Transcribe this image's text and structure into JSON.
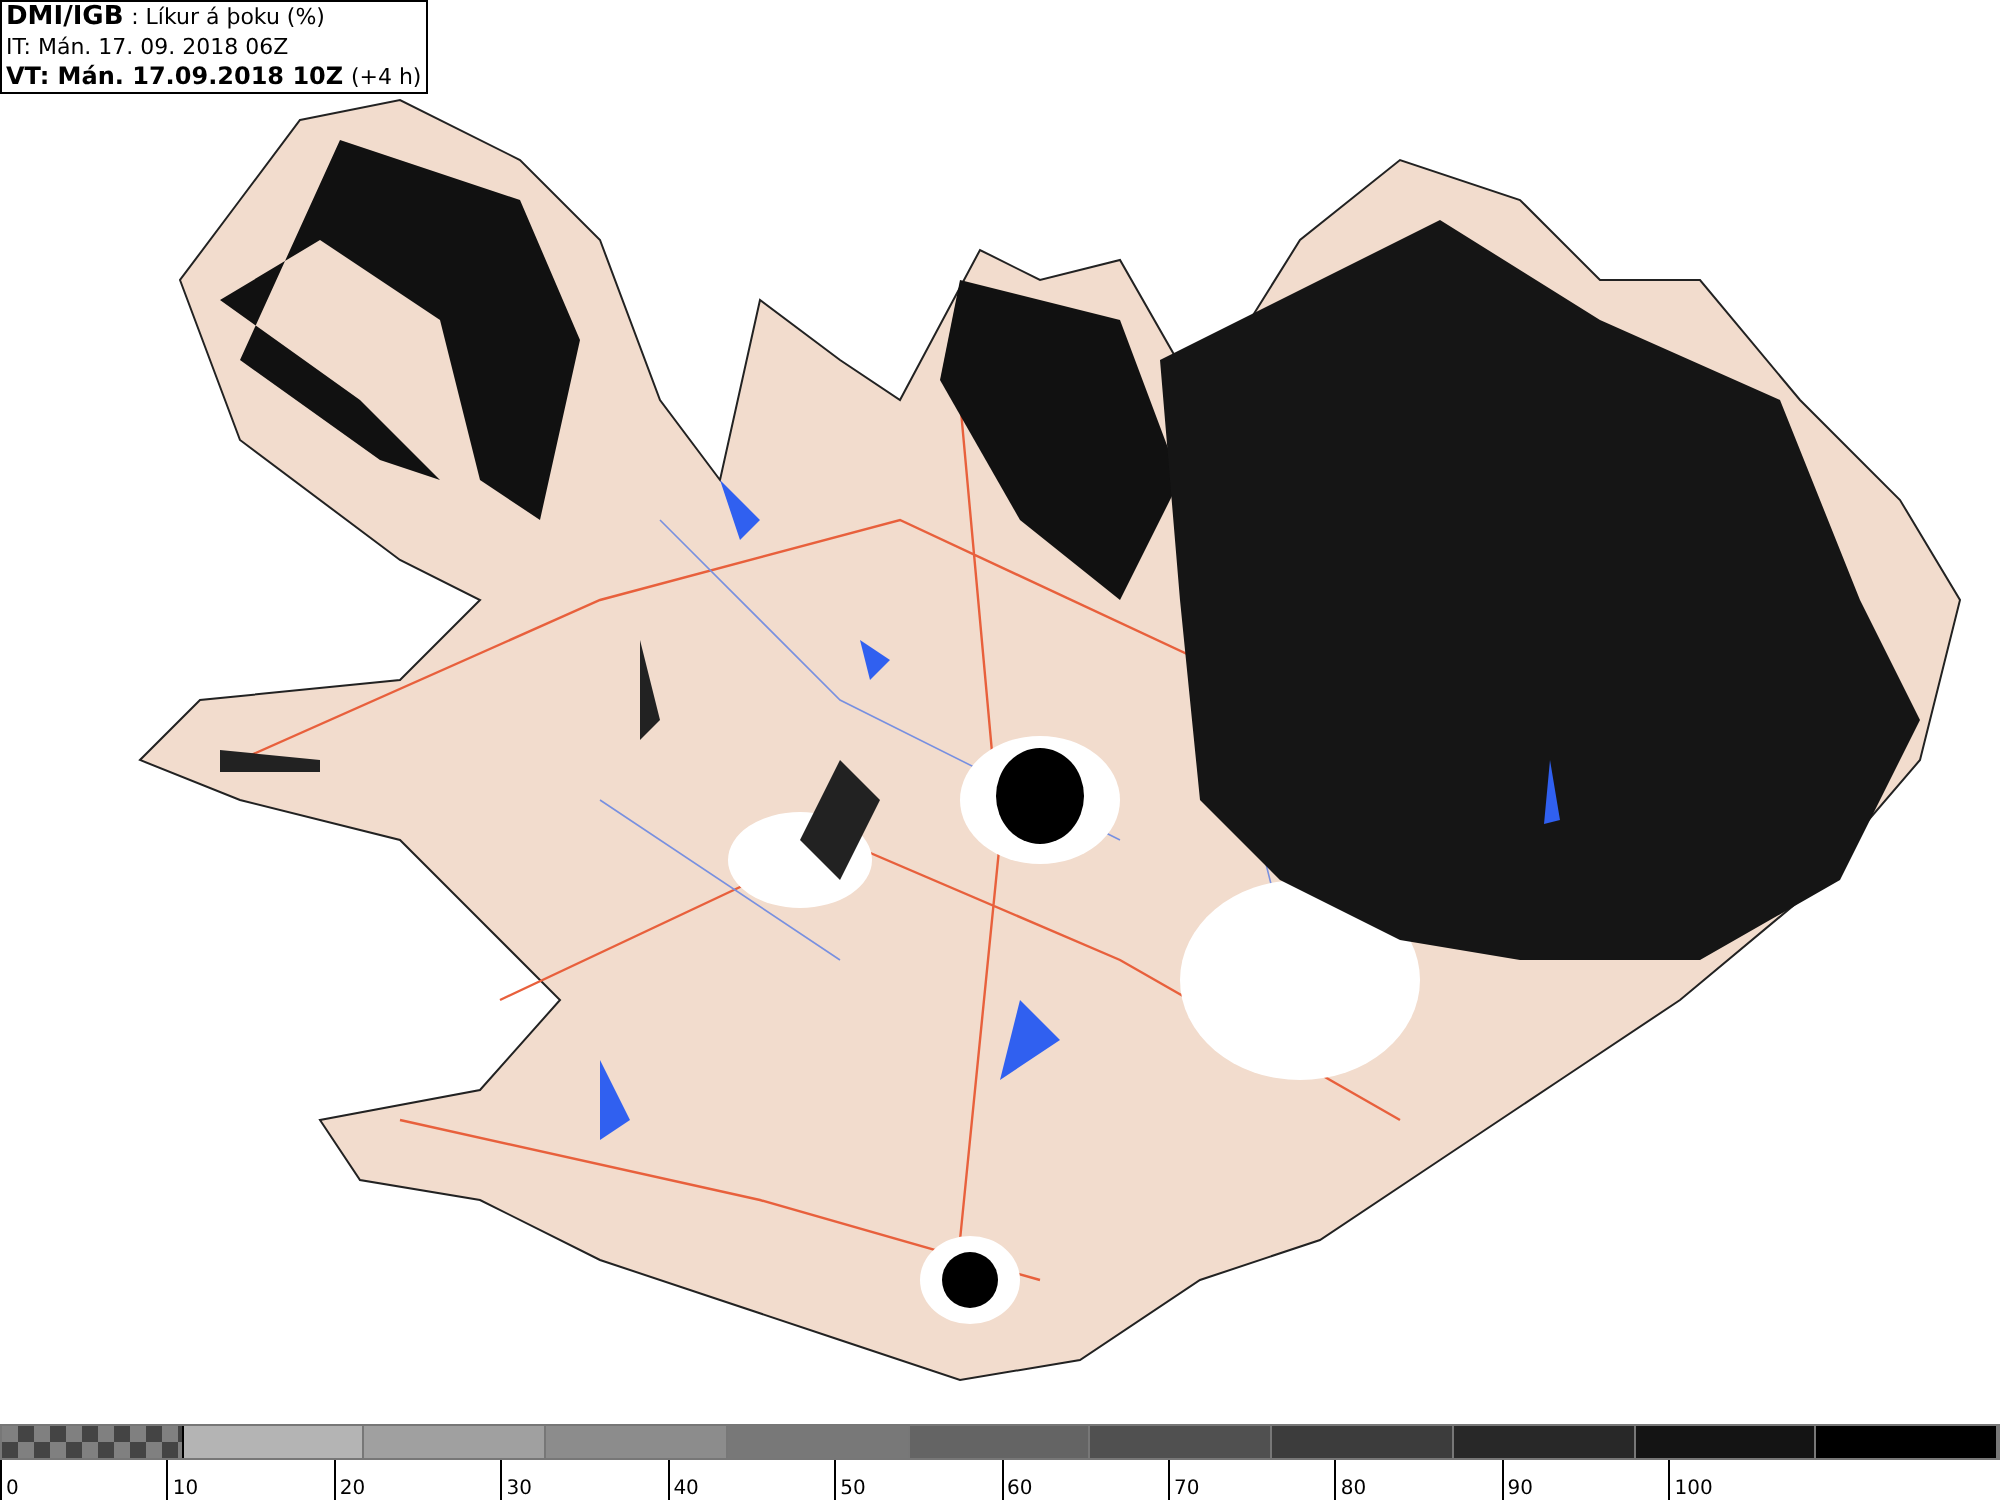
{
  "header": {
    "source": "DMI/IGB",
    "title": ": Líkur á þoku (%)",
    "issue_time": "IT: Mán. 17. 09. 2018 06Z",
    "valid_time": "VT: Mán. 17.09.2018 10Z",
    "lead": "(+4 h)"
  },
  "legend": {
    "segments": [
      {
        "kind": "checker",
        "color": "#808080"
      },
      {
        "kind": "solid",
        "color": "#b4b4b4"
      },
      {
        "kind": "solid",
        "color": "#a0a0a0"
      },
      {
        "kind": "solid",
        "color": "#8c8c8c"
      },
      {
        "kind": "solid",
        "color": "#787878"
      },
      {
        "kind": "solid",
        "color": "#646464"
      },
      {
        "kind": "solid",
        "color": "#505050"
      },
      {
        "kind": "solid",
        "color": "#3c3c3c"
      },
      {
        "kind": "solid",
        "color": "#282828"
      },
      {
        "kind": "solid",
        "color": "#141414"
      },
      {
        "kind": "solid",
        "color": "#000000"
      }
    ],
    "labels": [
      "0",
      "10",
      "20",
      "30",
      "40",
      "50",
      "60",
      "70",
      "80",
      "90",
      "100"
    ]
  }
}
